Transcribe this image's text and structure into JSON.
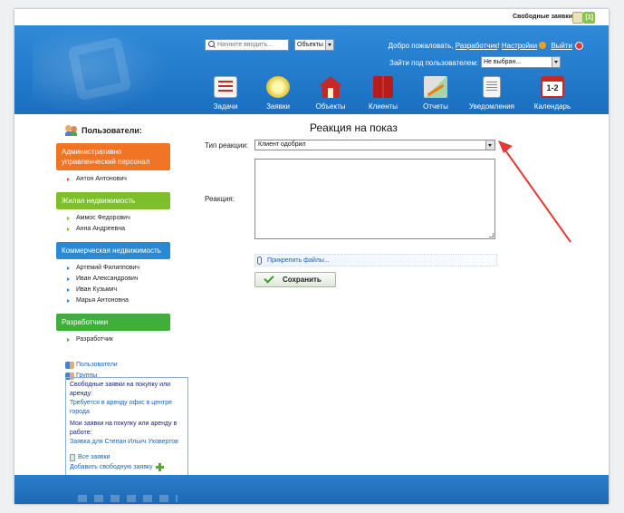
{
  "topbar": {
    "free_requests_label": "Свободные заявки",
    "free_requests_count": "[1]"
  },
  "header": {
    "search_placeholder": "Начните вводить...",
    "search_scope": "Объекты",
    "welcome_prefix": "Добро пожаловать,",
    "user_name": "Разработчик",
    "welcome_suffix": "!",
    "settings_label": "Настройки",
    "logout_label": "Выйти",
    "login_as_label": "Зайти под пользователем:",
    "login_as_value": "Не выбран..."
  },
  "nav": [
    {
      "label": "Задачи",
      "icon": "tasks-icon"
    },
    {
      "label": "Заявки",
      "icon": "requests-icon"
    },
    {
      "label": "Объекты",
      "icon": "house-icon"
    },
    {
      "label": "Клиенты",
      "icon": "clients-book-icon"
    },
    {
      "label": "Отчеты",
      "icon": "chart-icon"
    },
    {
      "label": "Уведомления",
      "icon": "notification-icon"
    },
    {
      "label": "Календарь",
      "icon": "calendar-icon",
      "badge": "1-2"
    }
  ],
  "sidebar": {
    "title": "Пользователи:",
    "groups": [
      {
        "title": "Административно управленческий персонал",
        "color": "#f07424",
        "items": [
          "Антон Антонович"
        ]
      },
      {
        "title": "Жилая недвижимость",
        "color": "#7cbf28",
        "items": [
          "Аммос Федорович",
          "Анна Андреевна"
        ]
      },
      {
        "title": "Коммерческая недвижимость",
        "color": "#2889d4",
        "items": [
          "Артемий Филиппович",
          "Иван Александрович",
          "Иван Кузьмич",
          "Марья Антоновна"
        ]
      },
      {
        "title": "Разработчики",
        "color": "#3fae3a",
        "items": [
          "Разработчик"
        ]
      }
    ],
    "links": {
      "users": "Пользователи",
      "groups": "Группы"
    },
    "free_box": {
      "free_heading": "Свободные заявки на покупку или аренду:",
      "free_link": "Требуется в аренду офис в центре города",
      "my_heading": "Мои заявки на покупку или аренду в работе:",
      "my_link": "Заявка для Степан Ильич Уховертов",
      "all_link": "Все заявки",
      "add_link": "Добавить свободную заявку"
    }
  },
  "form": {
    "title": "Реакция на показ",
    "type_label": "Тип реакции:",
    "type_value": "Клиент одобрил",
    "reaction_label": "Реакция:",
    "reaction_value": "",
    "attach_label": "Прикрепить файлы...",
    "save_label": "Сохранить"
  },
  "colors": {
    "header_blue": "#1a6fc0",
    "link_blue": "#1b63b8",
    "annotation_red": "#e53935"
  }
}
